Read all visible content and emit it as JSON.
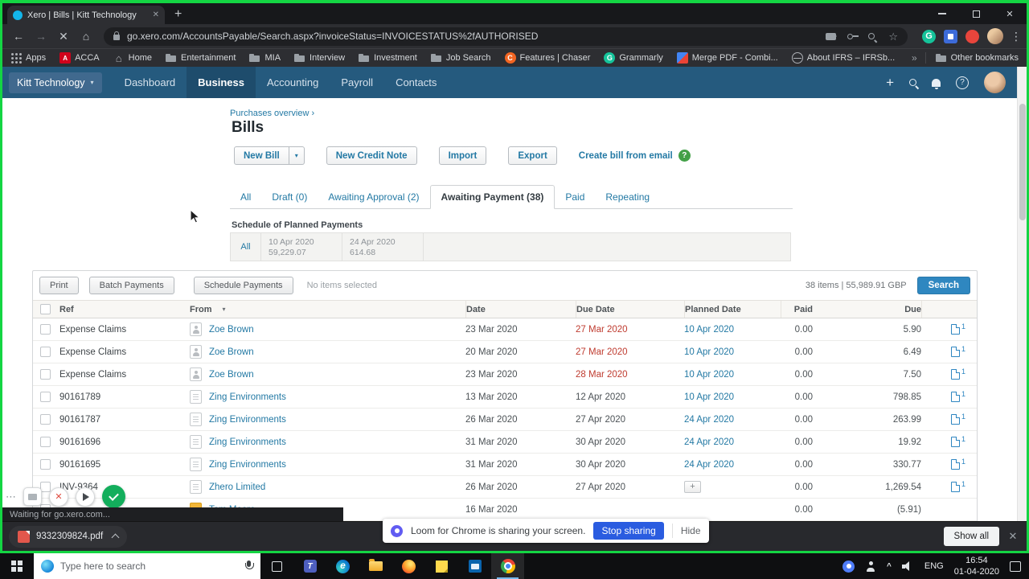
{
  "colors": {
    "share_border_green": "#14d543",
    "xero_nav_blue": "#255a7e",
    "link_blue": "#2379a4",
    "overdue_red": "#bf3b2f",
    "search_button_blue": "#2f87c0",
    "stop_sharing_blue": "#2a5ce0"
  },
  "browser": {
    "tab_title": "Xero | Bills | Kitt Technology",
    "url": "go.xero.com/AccountsPayable/Search.aspx?invoiceStatus=INVOICESTATUS%2fAUTHORISED",
    "bookmarks": [
      {
        "label": "Apps",
        "icon": "apps"
      },
      {
        "label": "ACCA",
        "icon": "acca"
      },
      {
        "label": "Home",
        "icon": "home"
      },
      {
        "label": "Entertainment",
        "icon": "folder"
      },
      {
        "label": "MIA",
        "icon": "folder"
      },
      {
        "label": "Interview",
        "icon": "folder"
      },
      {
        "label": "Investment",
        "icon": "folder"
      },
      {
        "label": "Job Search",
        "icon": "folder"
      },
      {
        "label": "Features | Chaser",
        "icon": "chaser"
      },
      {
        "label": "Grammarly",
        "icon": "grammarly"
      },
      {
        "label": "Merge PDF - Combi...",
        "icon": "merge"
      },
      {
        "label": "About IFRS – IFRSb...",
        "icon": "globe"
      }
    ],
    "other_bookmarks": "Other bookmarks",
    "status_text": "Waiting for go.xero.com...",
    "download_file": "9332309824.pdf",
    "show_all_label": "Show all"
  },
  "xero": {
    "org": "Kitt Technology",
    "nav": [
      {
        "label": "Dashboard"
      },
      {
        "label": "Business",
        "state": "active"
      },
      {
        "label": "Accounting"
      },
      {
        "label": "Payroll"
      },
      {
        "label": "Contacts"
      }
    ],
    "breadcrumb": "Purchases overview ›",
    "title": "Bills",
    "actions": {
      "new_bill": "New Bill",
      "new_credit_note": "New Credit Note",
      "import": "Import",
      "export": "Export",
      "create_from_email": "Create bill from email"
    },
    "tabs": [
      {
        "label": "All"
      },
      {
        "label": "Draft (0)"
      },
      {
        "label": "Awaiting Approval (2)"
      },
      {
        "label": "Awaiting Payment (38)",
        "state": "active"
      },
      {
        "label": "Paid"
      },
      {
        "label": "Repeating"
      }
    ],
    "schedule_heading": "Schedule of Planned Payments",
    "schedule": {
      "all": "All",
      "groups": [
        {
          "date": "10 Apr 2020",
          "amount": "59,229.07"
        },
        {
          "date": "24 Apr 2020",
          "amount": "614.68"
        }
      ]
    },
    "toolbar": {
      "print": "Print",
      "batch_payments": "Batch Payments",
      "schedule_payments": "Schedule Payments",
      "selection": "No items selected",
      "summary": "38 items | 55,989.91 GBP",
      "search": "Search"
    },
    "table": {
      "headers": {
        "ref": "Ref",
        "from": "From",
        "date": "Date",
        "due_date": "Due Date",
        "planned_date": "Planned Date",
        "paid": "Paid",
        "due": "Due"
      },
      "rows": [
        {
          "ref": "Expense Claims",
          "icon": "person",
          "from": "Zoe Brown",
          "date": "23 Mar 2020",
          "due_date": "27 Mar 2020",
          "overdue": true,
          "planned": "10 Apr 2020",
          "planned_type": "link",
          "paid": "0.00",
          "due": "5.90",
          "attachments": "1"
        },
        {
          "ref": "Expense Claims",
          "icon": "person",
          "from": "Zoe Brown",
          "date": "20 Mar 2020",
          "due_date": "27 Mar 2020",
          "overdue": true,
          "planned": "10 Apr 2020",
          "planned_type": "link",
          "paid": "0.00",
          "due": "6.49",
          "attachments": "1"
        },
        {
          "ref": "Expense Claims",
          "icon": "person",
          "from": "Zoe Brown",
          "date": "23 Mar 2020",
          "due_date": "28 Mar 2020",
          "overdue": true,
          "planned": "10 Apr 2020",
          "planned_type": "link",
          "paid": "0.00",
          "due": "7.50",
          "attachments": "1"
        },
        {
          "ref": "90161789",
          "icon": "doc",
          "from": "Zing Environments",
          "date": "13 Mar 2020",
          "due_date": "12 Apr 2020",
          "overdue": false,
          "planned": "10 Apr 2020",
          "planned_type": "link",
          "paid": "0.00",
          "due": "798.85",
          "attachments": "1"
        },
        {
          "ref": "90161787",
          "icon": "doc",
          "from": "Zing Environments",
          "date": "26 Mar 2020",
          "due_date": "27 Apr 2020",
          "overdue": false,
          "planned": "24 Apr 2020",
          "planned_type": "link",
          "paid": "0.00",
          "due": "263.99",
          "attachments": "1"
        },
        {
          "ref": "90161696",
          "icon": "doc",
          "from": "Zing Environments",
          "date": "31 Mar 2020",
          "due_date": "30 Apr 2020",
          "overdue": false,
          "planned": "24 Apr 2020",
          "planned_type": "link",
          "paid": "0.00",
          "due": "19.92",
          "attachments": "1"
        },
        {
          "ref": "90161695",
          "icon": "doc",
          "from": "Zing Environments",
          "date": "31 Mar 2020",
          "due_date": "30 Apr 2020",
          "overdue": false,
          "planned": "24 Apr 2020",
          "planned_type": "link",
          "paid": "0.00",
          "due": "330.77",
          "attachments": "1"
        },
        {
          "ref": "INV-9364",
          "icon": "doc",
          "from": "Zhero Limited",
          "date": "26 Mar 2020",
          "due_date": "27 Apr 2020",
          "overdue": false,
          "planned": "",
          "planned_type": "add",
          "paid": "0.00",
          "due": "1,269.54",
          "attachments": "1"
        },
        {
          "ref": "",
          "icon": "org",
          "from": "Tom Moore",
          "date": "16 Mar 2020",
          "due_date": "",
          "overdue": false,
          "planned": "",
          "planned_type": "none",
          "paid": "0.00",
          "due": "(5.91)",
          "attachments": ""
        }
      ]
    }
  },
  "loom": {
    "message": "Loom for Chrome is sharing your screen.",
    "stop": "Stop sharing",
    "hide": "Hide"
  },
  "taskbar": {
    "search_placeholder": "Type here to search",
    "apps": [
      {
        "icon": "task-view"
      },
      {
        "icon": "teams"
      },
      {
        "icon": "edge"
      },
      {
        "icon": "file-explorer"
      },
      {
        "icon": "firefox"
      },
      {
        "icon": "sticky-notes"
      },
      {
        "icon": "outlook"
      },
      {
        "icon": "chrome",
        "state": "active"
      }
    ],
    "lang": "ENG",
    "time": "16:54",
    "date": "01-04-2020"
  }
}
